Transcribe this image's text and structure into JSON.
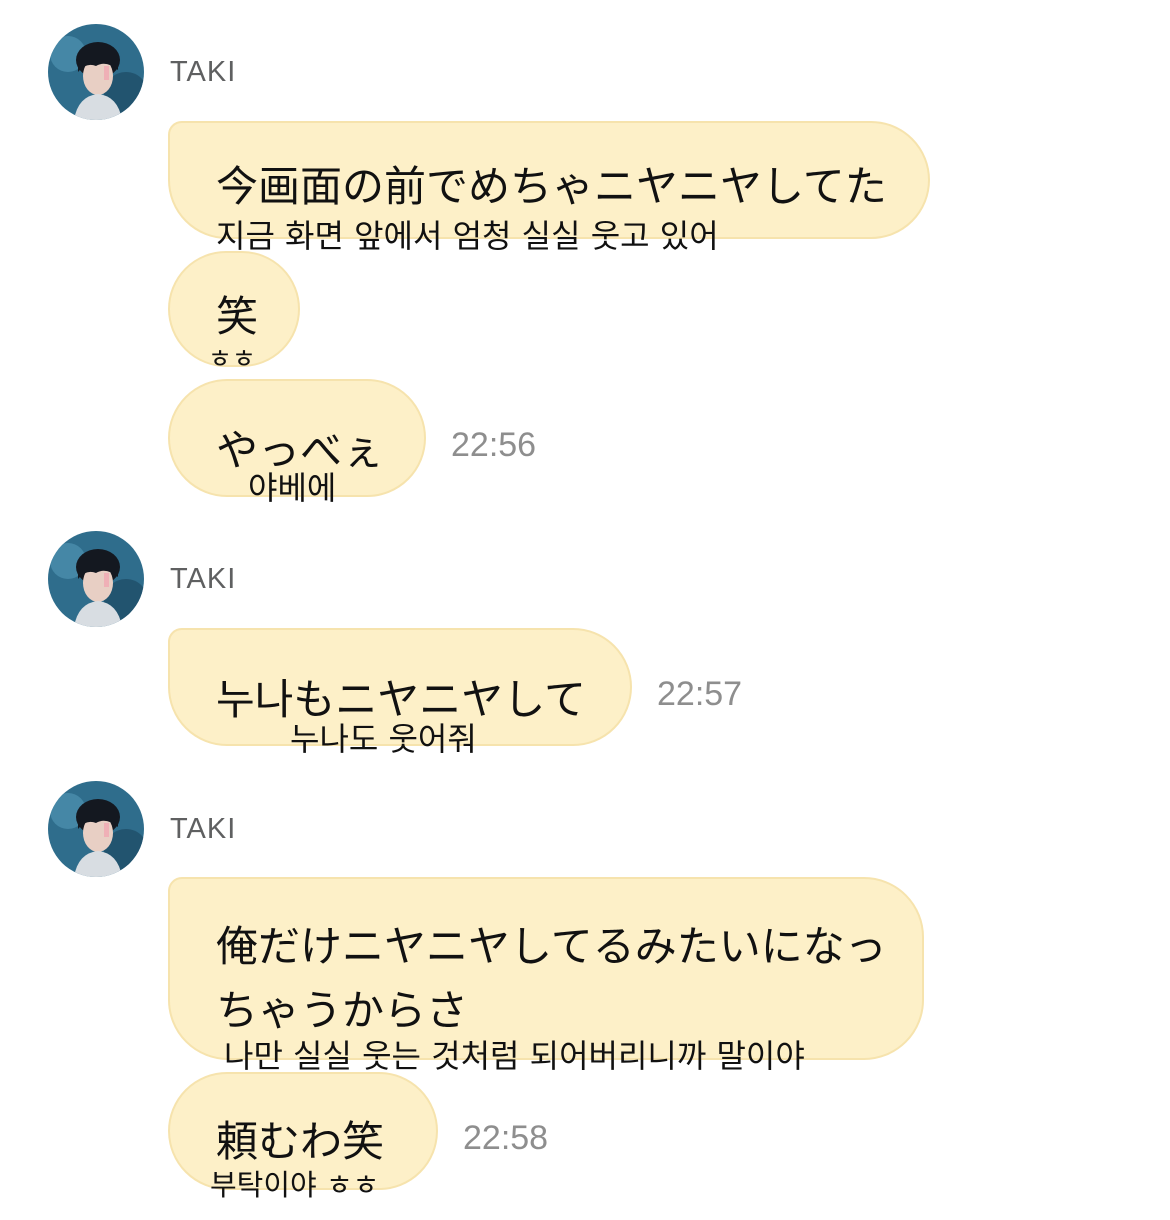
{
  "groups": [
    {
      "sender": "TAKI",
      "messages": [
        {
          "jp": "今画面の前でめちゃニヤニヤしてた",
          "kr": "지금 화면 앞에서 엄청 실실 웃고 있어"
        },
        {
          "jp": "笑",
          "kr": "ㅎㅎ"
        },
        {
          "jp": "やっべぇ",
          "kr": "야베에",
          "time": "22:56"
        }
      ]
    },
    {
      "sender": "TAKI",
      "messages": [
        {
          "jp": "누나もニヤニヤして",
          "kr": "누나도 웃어줘",
          "time": "22:57"
        }
      ]
    },
    {
      "sender": "TAKI",
      "messages": [
        {
          "jp_line1": "俺だけニヤニヤしてるみたいになっ",
          "jp_line2": "ちゃうからさ",
          "kr": "나만 실실 웃는 것처럼 되어버리니까 말이야"
        },
        {
          "jp": "頼むわ笑",
          "kr": "부탁이야 ㅎㅎ",
          "time": "22:58"
        }
      ]
    }
  ],
  "colors": {
    "bubble": "#fdf0c8",
    "bubble_border": "#f6e3ad",
    "time": "#8e8e8e",
    "sender": "#5f6061"
  },
  "icons": {
    "avatar": "profile-photo-avatar"
  }
}
